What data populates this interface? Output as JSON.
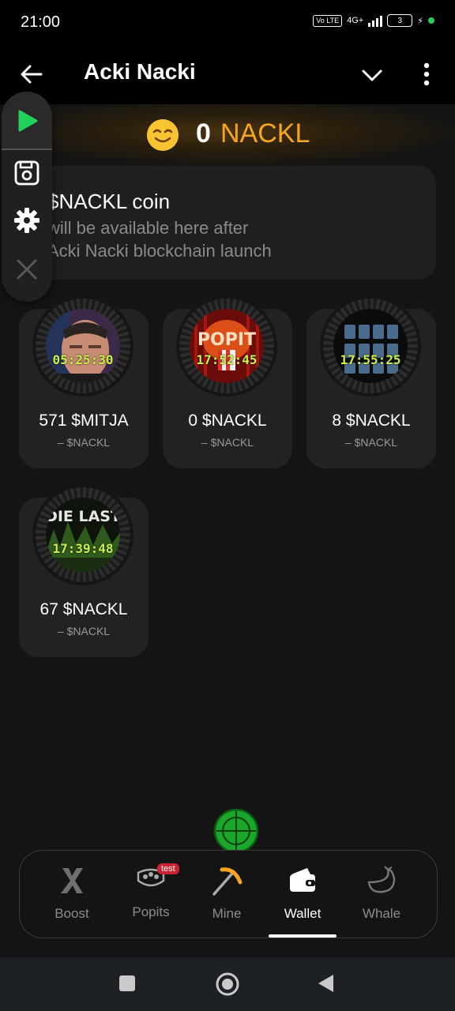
{
  "status_bar": {
    "time": "21:00",
    "volte": "Vo LTE",
    "network": "4G+",
    "battery": "3"
  },
  "header": {
    "title": "Acki Nacki"
  },
  "balance": {
    "amount": "0",
    "unit": "NACKL"
  },
  "info_card": {
    "title": "$NACKL coin",
    "line1": "will be available here after",
    "line2": "Acki Nacki blockchain launch"
  },
  "cards": [
    {
      "timer": "05:25:30",
      "amount": "571 $MITJA",
      "sub": "– $NACKL"
    },
    {
      "timer": "17:52:45",
      "amount": "0 $NACKL",
      "sub": "– $NACKL"
    },
    {
      "timer": "17:55:25",
      "amount": "8 $NACKL",
      "sub": "– $NACKL"
    },
    {
      "timer": "17:39:48",
      "amount": "67 $NACKL",
      "sub": "– $NACKL",
      "thumb_text": "DIE LAST"
    }
  ],
  "popit_text": "POPIT",
  "nav": {
    "items": [
      {
        "label": "Boost",
        "icon": "x-icon"
      },
      {
        "label": "Popits",
        "icon": "popit-icon",
        "badge": "test"
      },
      {
        "label": "Mine",
        "icon": "pickaxe-icon"
      },
      {
        "label": "Wallet",
        "icon": "wallet-icon",
        "active": true
      },
      {
        "label": "Whale",
        "icon": "whale-icon"
      }
    ]
  },
  "colors": {
    "accent_orange": "#f6a623",
    "timer_green": "#cdf04a",
    "play_green": "#22d15a"
  }
}
